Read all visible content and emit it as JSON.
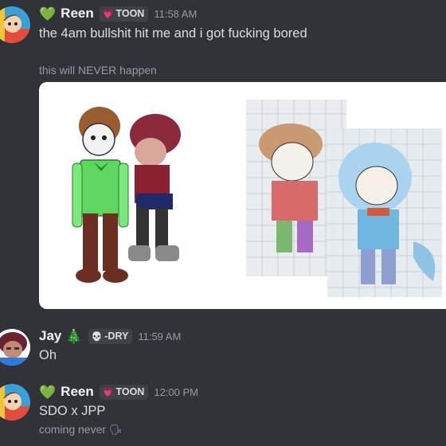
{
  "messages": [
    {
      "author": "Reen",
      "status_emoji": "💚",
      "tag_icon": "heart-icon",
      "tag": "TOON",
      "timestamp": "11:58 AM",
      "text": "the 4am bullshit hit me and i got fucking bored",
      "caption": "this will NEVER happen"
    },
    {
      "author": "Jay",
      "status_emoji": "🎄",
      "tag_icon": "skull-icon",
      "tag": "-DRY",
      "timestamp": "11:59 AM",
      "text": "Oh"
    },
    {
      "author": "Reen",
      "status_emoji": "💚",
      "tag_icon": "heart-icon",
      "tag": "TOON",
      "timestamp": "12:00 PM",
      "text": "SDO x JPP",
      "subtext": "coming never"
    }
  ],
  "colors": {
    "background": "#313338",
    "text": "#dbdee1",
    "muted": "#949ba4",
    "tag_bg": "#3f4147",
    "heart_green": "#3ed35a"
  }
}
